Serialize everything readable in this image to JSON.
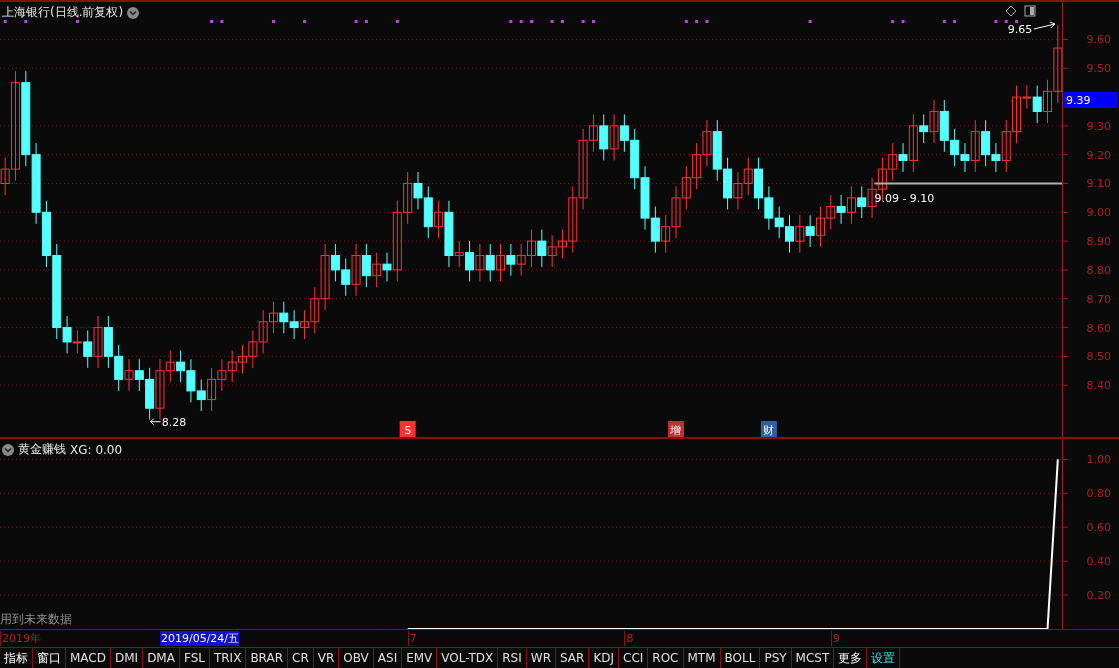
{
  "price_panel": {
    "title": "上海银行(日线.前复权)",
    "last_price": "9.39",
    "high_label": "9.65",
    "low_label": "8.28",
    "range_label": "9.09 - 9.10",
    "events": [
      {
        "label": "S",
        "color": "#ff3232"
      },
      {
        "label": "增",
        "color": "#c03030"
      },
      {
        "label": "财",
        "color": "#3060a0"
      }
    ],
    "chart_data": {
      "type": "candlestick",
      "grid": true,
      "ylim": [
        8.22,
        9.73
      ],
      "yticks": [
        {
          "value": 8.4,
          "label": "8.40"
        },
        {
          "value": 8.5,
          "label": "8.50"
        },
        {
          "value": 8.6,
          "label": "8.60"
        },
        {
          "value": 8.7,
          "label": "8.70"
        },
        {
          "value": 8.8,
          "label": "8.80"
        },
        {
          "value": 8.9,
          "label": "8.90"
        },
        {
          "value": 9.0,
          "label": "9.00"
        },
        {
          "value": 9.1,
          "label": "9.10"
        },
        {
          "value": 9.2,
          "label": "9.20"
        },
        {
          "value": 9.3,
          "label": "9.30"
        },
        {
          "value": 9.5,
          "label": "9.50"
        },
        {
          "value": 9.6,
          "label": "9.60"
        }
      ],
      "ohlc": [
        [
          9.1,
          9.19,
          9.06,
          9.15
        ],
        [
          9.15,
          9.49,
          9.11,
          9.45
        ],
        [
          9.45,
          9.49,
          9.16,
          9.2
        ],
        [
          9.2,
          9.24,
          8.96,
          9.0
        ],
        [
          9.0,
          9.04,
          8.81,
          8.85
        ],
        [
          8.85,
          8.89,
          8.56,
          8.6
        ],
        [
          8.6,
          8.64,
          8.51,
          8.55
        ],
        [
          8.55,
          8.59,
          8.51,
          8.55
        ],
        [
          8.55,
          8.59,
          8.46,
          8.5
        ],
        [
          8.5,
          8.64,
          8.46,
          8.6
        ],
        [
          8.6,
          8.64,
          8.46,
          8.5
        ],
        [
          8.5,
          8.54,
          8.38,
          8.42
        ],
        [
          8.42,
          8.49,
          8.38,
          8.45
        ],
        [
          8.45,
          8.49,
          8.38,
          8.42
        ],
        [
          8.42,
          8.46,
          8.28,
          8.32
        ],
        [
          8.32,
          8.49,
          8.28,
          8.45
        ],
        [
          8.45,
          8.52,
          8.41,
          8.48
        ],
        [
          8.48,
          8.52,
          8.41,
          8.45
        ],
        [
          8.45,
          8.49,
          8.34,
          8.38
        ],
        [
          8.38,
          8.42,
          8.31,
          8.35
        ],
        [
          8.35,
          8.46,
          8.31,
          8.42
        ],
        [
          8.42,
          8.49,
          8.38,
          8.45
        ],
        [
          8.45,
          8.52,
          8.41,
          8.48
        ],
        [
          8.48,
          8.54,
          8.44,
          8.5
        ],
        [
          8.5,
          8.59,
          8.46,
          8.55
        ],
        [
          8.55,
          8.66,
          8.51,
          8.62
        ],
        [
          8.62,
          8.69,
          8.58,
          8.65
        ],
        [
          8.65,
          8.69,
          8.58,
          8.62
        ],
        [
          8.62,
          8.66,
          8.56,
          8.6
        ],
        [
          8.6,
          8.66,
          8.56,
          8.62
        ],
        [
          8.62,
          8.74,
          8.58,
          8.7
        ],
        [
          8.7,
          8.89,
          8.66,
          8.85
        ],
        [
          8.85,
          8.89,
          8.76,
          8.8
        ],
        [
          8.8,
          8.84,
          8.71,
          8.75
        ],
        [
          8.75,
          8.89,
          8.71,
          8.85
        ],
        [
          8.85,
          8.89,
          8.74,
          8.78
        ],
        [
          8.78,
          8.86,
          8.74,
          8.82
        ],
        [
          8.82,
          8.86,
          8.76,
          8.8
        ],
        [
          8.8,
          9.04,
          8.76,
          9.0
        ],
        [
          9.0,
          9.14,
          8.96,
          9.1
        ],
        [
          9.1,
          9.14,
          9.01,
          9.05
        ],
        [
          9.05,
          9.09,
          8.91,
          8.95
        ],
        [
          8.95,
          9.04,
          8.91,
          9.0
        ],
        [
          9.0,
          9.04,
          8.81,
          8.85
        ],
        [
          8.85,
          8.9,
          8.81,
          8.86
        ],
        [
          8.86,
          8.9,
          8.76,
          8.8
        ],
        [
          8.8,
          8.89,
          8.76,
          8.85
        ],
        [
          8.85,
          8.89,
          8.76,
          8.8
        ],
        [
          8.8,
          8.89,
          8.76,
          8.85
        ],
        [
          8.85,
          8.89,
          8.78,
          8.82
        ],
        [
          8.82,
          8.89,
          8.78,
          8.85
        ],
        [
          8.85,
          8.94,
          8.81,
          8.9
        ],
        [
          8.9,
          8.94,
          8.81,
          8.85
        ],
        [
          8.85,
          8.92,
          8.81,
          8.88
        ],
        [
          8.88,
          8.94,
          8.84,
          8.9
        ],
        [
          8.9,
          9.09,
          8.86,
          9.05
        ],
        [
          9.05,
          9.29,
          9.01,
          9.25
        ],
        [
          9.25,
          9.34,
          9.21,
          9.3
        ],
        [
          9.3,
          9.34,
          9.18,
          9.22
        ],
        [
          9.22,
          9.34,
          9.18,
          9.3
        ],
        [
          9.3,
          9.34,
          9.21,
          9.25
        ],
        [
          9.25,
          9.29,
          9.08,
          9.12
        ],
        [
          9.12,
          9.16,
          8.94,
          8.98
        ],
        [
          8.98,
          9.02,
          8.86,
          8.9
        ],
        [
          8.9,
          8.99,
          8.86,
          8.95
        ],
        [
          8.95,
          9.09,
          8.91,
          9.05
        ],
        [
          9.05,
          9.16,
          9.01,
          9.12
        ],
        [
          9.12,
          9.24,
          9.08,
          9.2
        ],
        [
          9.2,
          9.32,
          9.16,
          9.28
        ],
        [
          9.28,
          9.32,
          9.11,
          9.15
        ],
        [
          9.15,
          9.19,
          9.01,
          9.05
        ],
        [
          9.05,
          9.14,
          9.01,
          9.1
        ],
        [
          9.1,
          9.19,
          9.06,
          9.15
        ],
        [
          9.15,
          9.19,
          9.01,
          9.05
        ],
        [
          9.05,
          9.09,
          8.94,
          8.98
        ],
        [
          8.98,
          9.02,
          8.91,
          8.95
        ],
        [
          8.95,
          8.99,
          8.86,
          8.9
        ],
        [
          8.9,
          8.99,
          8.86,
          8.95
        ],
        [
          8.95,
          8.99,
          8.88,
          8.92
        ],
        [
          8.92,
          9.02,
          8.88,
          8.98
        ],
        [
          8.98,
          9.06,
          8.94,
          9.02
        ],
        [
          9.02,
          9.06,
          8.96,
          9.0
        ],
        [
          9.0,
          9.09,
          8.96,
          9.05
        ],
        [
          9.05,
          9.09,
          8.98,
          9.02
        ],
        [
          9.02,
          9.12,
          8.98,
          9.08
        ],
        [
          9.08,
          9.19,
          9.04,
          9.15
        ],
        [
          9.15,
          9.24,
          9.11,
          9.2
        ],
        [
          9.2,
          9.24,
          9.14,
          9.18
        ],
        [
          9.18,
          9.34,
          9.14,
          9.3
        ],
        [
          9.3,
          9.34,
          9.24,
          9.28
        ],
        [
          9.28,
          9.39,
          9.24,
          9.35
        ],
        [
          9.35,
          9.39,
          9.21,
          9.25
        ],
        [
          9.25,
          9.29,
          9.16,
          9.2
        ],
        [
          9.2,
          9.24,
          9.14,
          9.18
        ],
        [
          9.18,
          9.32,
          9.14,
          9.28
        ],
        [
          9.28,
          9.32,
          9.16,
          9.2
        ],
        [
          9.2,
          9.24,
          9.14,
          9.18
        ],
        [
          9.18,
          9.32,
          9.14,
          9.28
        ],
        [
          9.28,
          9.44,
          9.24,
          9.4
        ],
        [
          9.4,
          9.44,
          9.36,
          9.4
        ],
        [
          9.4,
          9.44,
          9.31,
          9.35
        ],
        [
          9.35,
          9.46,
          9.31,
          9.42
        ],
        [
          9.42,
          9.65,
          9.38,
          9.57
        ]
      ]
    }
  },
  "indicator_panel": {
    "title": "黄金赚钱",
    "reading": "XG: 0.00",
    "note": "用到未来数据",
    "chart_data": {
      "type": "line",
      "grid": true,
      "ylim": [
        0,
        1.12
      ],
      "yticks": [
        {
          "value": 0.2,
          "label": "0.20"
        },
        {
          "value": 0.4,
          "label": "0.40"
        },
        {
          "value": 0.6,
          "label": "0.60"
        },
        {
          "value": 0.8,
          "label": "0.80"
        },
        {
          "value": 1.0,
          "label": "1.00"
        }
      ],
      "series": [
        {
          "color": "#ffffff",
          "values": [
            null,
            null,
            null,
            null,
            null,
            null,
            null,
            null,
            null,
            null,
            null,
            null,
            null,
            null,
            null,
            null,
            null,
            null,
            null,
            null,
            null,
            null,
            null,
            null,
            null,
            null,
            null,
            null,
            null,
            null,
            null,
            null,
            null,
            null,
            null,
            null,
            null,
            null,
            null,
            0,
            0,
            0,
            0,
            0,
            0,
            0,
            0,
            0,
            0,
            0,
            0,
            0,
            0,
            0,
            0,
            0,
            0,
            0,
            0,
            0,
            0,
            0,
            0,
            0,
            0,
            0,
            0,
            0,
            0,
            0,
            0,
            0,
            0,
            0,
            0,
            0,
            0,
            0,
            0,
            0,
            0,
            0,
            0,
            0,
            0,
            0,
            0,
            0,
            0,
            0,
            0,
            0,
            0,
            0,
            0,
            0,
            0,
            0,
            0,
            0,
            0,
            0,
            1
          ]
        }
      ]
    }
  },
  "date_axis": [
    {
      "label": "2019年",
      "selected": false
    },
    {
      "label": "2019/05/24/五",
      "selected": true
    },
    {
      "label": "7",
      "selected": false
    },
    {
      "label": "8",
      "selected": false
    },
    {
      "label": "9",
      "selected": false
    }
  ],
  "tabs": [
    {
      "label": "指标",
      "kind": "menu"
    },
    {
      "label": "窗口",
      "kind": "menu"
    },
    {
      "label": "MACD",
      "kind": "indicator"
    },
    {
      "label": "DMI",
      "kind": "indicator"
    },
    {
      "label": "DMA",
      "kind": "indicator"
    },
    {
      "label": "FSL",
      "kind": "indicator"
    },
    {
      "label": "TRIX",
      "kind": "indicator"
    },
    {
      "label": "BRAR",
      "kind": "indicator"
    },
    {
      "label": "CR",
      "kind": "indicator"
    },
    {
      "label": "VR",
      "kind": "indicator"
    },
    {
      "label": "OBV",
      "kind": "indicator"
    },
    {
      "label": "ASI",
      "kind": "indicator"
    },
    {
      "label": "EMV",
      "kind": "indicator"
    },
    {
      "label": "VOL-TDX",
      "kind": "indicator"
    },
    {
      "label": "RSI",
      "kind": "indicator"
    },
    {
      "label": "WR",
      "kind": "indicator"
    },
    {
      "label": "SAR",
      "kind": "indicator"
    },
    {
      "label": "KDJ",
      "kind": "indicator"
    },
    {
      "label": "CCI",
      "kind": "indicator"
    },
    {
      "label": "ROC",
      "kind": "indicator"
    },
    {
      "label": "MTM",
      "kind": "indicator"
    },
    {
      "label": "BOLL",
      "kind": "indicator"
    },
    {
      "label": "PSY",
      "kind": "indicator"
    },
    {
      "label": "MCST",
      "kind": "indicator"
    },
    {
      "label": "更多",
      "kind": "menu"
    },
    {
      "label": "设置",
      "kind": "settings"
    }
  ]
}
